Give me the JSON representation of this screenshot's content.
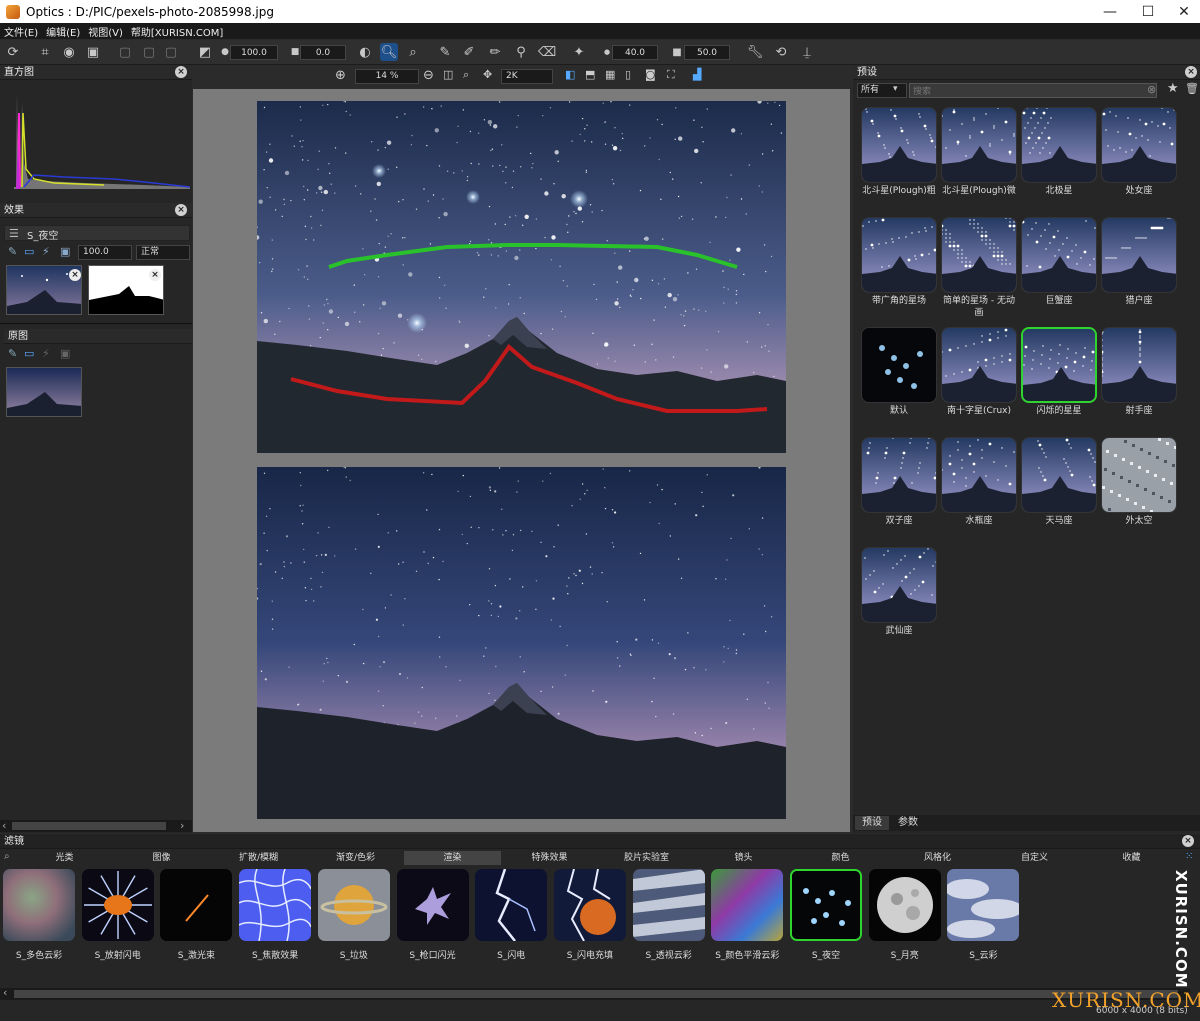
{
  "window": {
    "title": "Optics : D:/PIC/pexels-photo-2085998.jpg",
    "minimize": "—",
    "maximize": "☐",
    "close": "✕"
  },
  "menu": [
    "文件(E)",
    "编辑(E)",
    "视图(V)",
    "帮助[XURISN.COM]"
  ],
  "toolbar": {
    "opacity_value": "100.0",
    "angle_value": "0.0",
    "brush_size": "40.0",
    "brush_opacity": "50.0"
  },
  "view_toolbar": {
    "zoom_value": "14 %",
    "resolution": "2K"
  },
  "histogram_panel": {
    "title": "直方图"
  },
  "effects_panel": {
    "title": "效果",
    "layer_name": "S_夜空",
    "opacity": "100.0",
    "blend_mode": "正常"
  },
  "original_panel": {
    "title": "原图"
  },
  "presets_panel": {
    "title": "预设",
    "filter_value": "所有",
    "search_placeholder": "搜索",
    "items": [
      {
        "label": "北斗星(Plough)粗",
        "style": "mountain"
      },
      {
        "label": "北斗星(Plough)微",
        "style": "mountain"
      },
      {
        "label": "北极星",
        "style": "mountain"
      },
      {
        "label": "处女座",
        "style": "mountain"
      },
      {
        "label": "带广角的星场",
        "style": "mountain"
      },
      {
        "label": "简单的星场 - 无动画",
        "style": "field"
      },
      {
        "label": "巨蟹座",
        "style": "mountain"
      },
      {
        "label": "猎户座",
        "style": "mountain"
      },
      {
        "label": "默认",
        "style": "dark"
      },
      {
        "label": "南十字星(Crux)",
        "style": "mountain"
      },
      {
        "label": "闪烁的星星",
        "style": "mountain",
        "selected": true
      },
      {
        "label": "射手座",
        "style": "mountain"
      },
      {
        "label": "双子座",
        "style": "mountain"
      },
      {
        "label": "水瓶座",
        "style": "mountain"
      },
      {
        "label": "天马座",
        "style": "mountain"
      },
      {
        "label": "外太空",
        "style": "noise"
      },
      {
        "label": "武仙座",
        "style": "mountain"
      }
    ],
    "tabs": [
      "预设",
      "参数"
    ]
  },
  "filters_panel": {
    "title": "滤镜",
    "categories": [
      "光类",
      "图像",
      "扩散/模糊",
      "渐变/色彩",
      "渲染",
      "特殊效果",
      "胶片实验室",
      "镜头",
      "颜色",
      "风格化",
      "自定义",
      "收藏"
    ],
    "active_category": "渲染",
    "items": [
      {
        "label": "S_多色云彩",
        "style": "cloudcolor"
      },
      {
        "label": "S_放射闪电",
        "style": "radial"
      },
      {
        "label": "S_激光束",
        "style": "laser"
      },
      {
        "label": "S_焦散效果",
        "style": "caustic"
      },
      {
        "label": "S_垃圾",
        "style": "planet"
      },
      {
        "label": "S_枪口闪光",
        "style": "muzzle"
      },
      {
        "label": "S_闪电",
        "style": "lightning"
      },
      {
        "label": "S_闪电充填",
        "style": "lightfill"
      },
      {
        "label": "S_透视云彩",
        "style": "perspective"
      },
      {
        "label": "S_颜色平滑云彩",
        "style": "smooth"
      },
      {
        "label": "S_夜空",
        "style": "night",
        "selected": true
      },
      {
        "label": "S_月亮",
        "style": "moon"
      },
      {
        "label": "S_云彩",
        "style": "clouds"
      }
    ]
  },
  "status": {
    "image_size": "6000 x 4000 (8 bits)"
  },
  "watermark": {
    "side": "XURISN.COM",
    "bottom": "XURISN.COM"
  },
  "colors": {
    "accent_green": "#2fd52f",
    "panel_bg": "#262626",
    "canvas_bg": "#7b7b7b"
  }
}
